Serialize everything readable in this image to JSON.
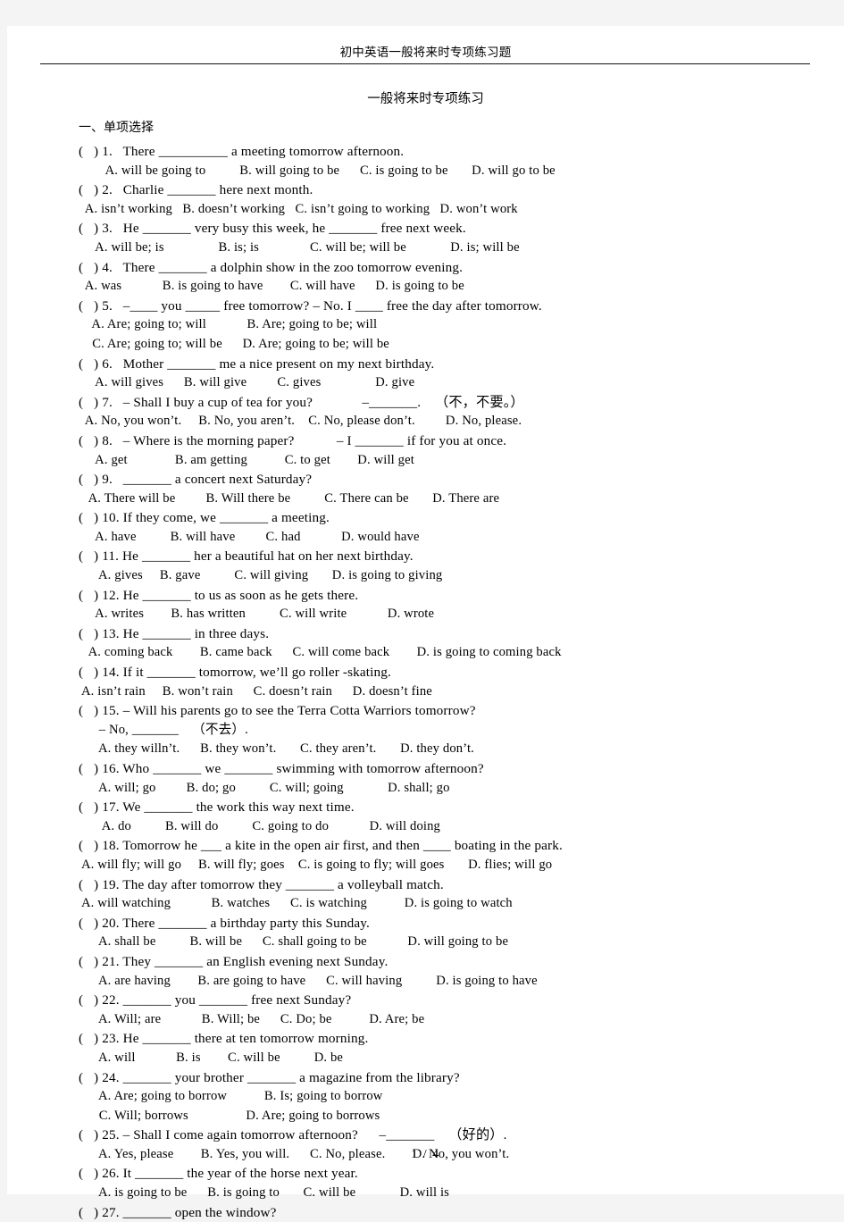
{
  "document": {
    "header_title": "初中英语一般将来时专项练习题",
    "title": "一般将来时专项练习",
    "section_heading": "一、单项选择",
    "footer": "1 / 4"
  },
  "questions": [
    {
      "stem": "(   ) 1.   There __________ a meeting tomorrow afternoon.",
      "options": [
        "        A. will be going to          B. will going to be      C. is going to be       D. will go to be"
      ]
    },
    {
      "stem": "(   ) 2.   Charlie _______ here next month.",
      "options": [
        "  A. isn’t working   B. doesn’t working   C. isn’t going to working   D. won’t work"
      ]
    },
    {
      "stem": "(   ) 3.   He _______ very busy this week, he _______ free next week.",
      "options": [
        "     A. will be; is                B. is; is               C. will be; will be             D. is; will be"
      ]
    },
    {
      "stem": "(   ) 4.   There _______ a dolphin show in the zoo tomorrow evening.",
      "options": [
        "  A. was            B. is going to have        C. will have      D. is going to be"
      ]
    },
    {
      "stem": "(   ) 5.   –____ you _____ free tomorrow? – No. I ____ free the day after tomorrow.",
      "options": [
        "    A. Are; going to; will            B. Are; going to be; will",
        "    C. Are; going to; will be      D. Are; going to be; will be"
      ]
    },
    {
      "stem": "(   ) 6.   Mother _______ me a nice present on my next birthday.",
      "options": [
        "     A. will gives      B. will give         C. gives                D. give"
      ]
    },
    {
      "stem": "(   ) 7.   – Shall I buy a cup of tea for you?              –_______.    （不，不要。）",
      "options": [
        "  A. No, you won’t.     B. No, you aren’t.    C. No, please don’t.         D. No, please."
      ]
    },
    {
      "stem": "(   ) 8.   – Where is the morning paper?            – I _______ if for you at once.",
      "options": [
        "     A. get              B. am getting           C. to get        D. will get"
      ]
    },
    {
      "stem": "(   ) 9.   _______ a concert next Saturday?",
      "options": [
        "   A. There will be         B. Will there be          C. There can be       D. There are"
      ]
    },
    {
      "stem": "(   ) 10. If they come, we _______ a meeting.",
      "options": [
        "     A. have          B. will have         C. had            D. would have"
      ]
    },
    {
      "stem": "(   ) 11. He _______ her a beautiful hat on her next birthday.",
      "options": [
        "      A. gives     B. gave          C. will giving       D. is going to giving"
      ]
    },
    {
      "stem": "(   ) 12. He _______ to us as soon as he gets there.",
      "options": [
        "     A. writes        B. has written          C. will write            D. wrote"
      ]
    },
    {
      "stem": "(   ) 13. He _______ in three days.",
      "options": [
        "   A. coming back        B. came back      C. will come back        D. is going to coming back"
      ]
    },
    {
      "stem": "(   ) 14. If it _______ tomorrow, we’ll go roller -skating.",
      "options": [
        " A. isn’t rain     B. won’t rain      C. doesn’t rain      D. doesn’t fine"
      ]
    },
    {
      "stem": "(   ) 15. – Will his parents go to see the Terra Cotta Warriors tomorrow?",
      "options": [
        "      – No, _______    （不去）.",
        "      A. they willn’t.      B. they won’t.       C. they aren’t.       D. they don’t."
      ]
    },
    {
      "stem": "(   ) 16. Who _______ we _______ swimming with tomorrow afternoon?",
      "options": [
        "      A. will; go         B. do; go          C. will; going             D. shall; go"
      ]
    },
    {
      "stem": "(   ) 17. We _______ the work this way next time.",
      "options": [
        "       A. do          B. will do          C. going to do            D. will doing"
      ]
    },
    {
      "stem": "(   ) 18. Tomorrow he ___ a kite in the open air first, and then ____ boating in the park.",
      "options": [
        " A. will fly; will go     B. will fly; goes    C. is going to fly; will goes       D. flies; will go"
      ]
    },
    {
      "stem": "(   ) 19. The day after tomorrow they _______ a volleyball match.",
      "options": [
        " A. will watching            B. watches      C. is watching           D. is going to watch"
      ]
    },
    {
      "stem": "(   ) 20. There _______ a birthday party this Sunday.",
      "options": [
        "      A. shall be          B. will be      C. shall going to be            D. will going to be"
      ]
    },
    {
      "stem": "(   ) 21. They _______ an English evening next Sunday.",
      "options": [
        "      A. are having        B. are going to have      C. will having          D. is going to have"
      ]
    },
    {
      "stem": "(   ) 22. _______ you _______ free next Sunday?",
      "options": [
        "      A. Will; are            B. Will; be      C. Do; be           D. Are; be"
      ]
    },
    {
      "stem": "(   ) 23. He _______ there at ten tomorrow morning.",
      "options": [
        "      A. will            B. is        C. will be          D. be"
      ]
    },
    {
      "stem": "(   ) 24. _______ your brother _______ a magazine from the library?",
      "options": [
        "      A. Are; going to borrow           B. Is; going to borrow",
        "      C. Will; borrows                 D. Are; going to borrows"
      ]
    },
    {
      "stem": "(   ) 25. – Shall I come again tomorrow afternoon?      –_______    （好的）.",
      "options": [
        "      A. Yes, please        B. Yes, you will.      C. No, please.        D. No, you won’t."
      ]
    },
    {
      "stem": "(   ) 26. It _______ the year of the horse next year.",
      "options": [
        "      A. is going to be      B. is going to       C. will be             D. will is"
      ]
    },
    {
      "stem": "(   ) 27. _______ open the window?",
      "options": []
    }
  ]
}
